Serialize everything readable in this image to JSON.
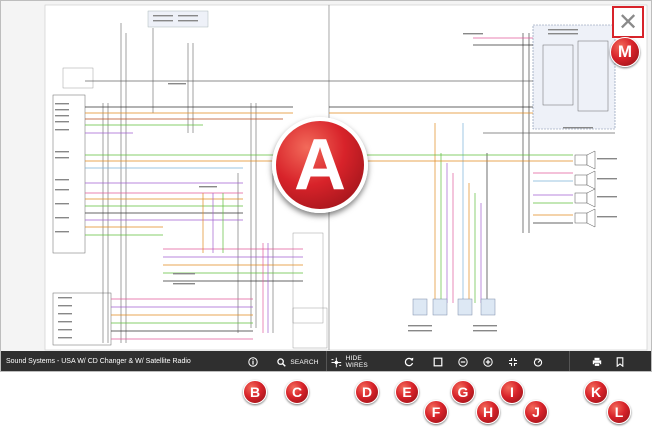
{
  "toolbar": {
    "title": "Sound Systems - USA W/ CD Changer & W/ Satellite Radio",
    "search_label": "SEARCH",
    "hide_wires_label": "HIDE WIRES"
  },
  "close": {
    "glyph": "✕"
  },
  "callouts": {
    "a": "A",
    "b": "B",
    "c": "C",
    "d": "D",
    "e": "E",
    "f": "F",
    "g": "G",
    "h": "H",
    "i": "I",
    "j": "J",
    "k": "K",
    "l": "L",
    "m": "M"
  },
  "colors": {
    "toolbar_bg": "#2f2f2f",
    "callout_red": "#d8232a",
    "wire_orange": "#e08a1e",
    "wire_green": "#5fbf3a",
    "wire_violet": "#a05fd0",
    "wire_pink": "#e05a9a"
  },
  "icons": [
    "info-icon",
    "search-icon",
    "hide-wires-icon",
    "rotate-icon",
    "fit-page-icon",
    "zoom-out-icon",
    "zoom-in-icon",
    "fullscreen-icon",
    "reset-icon",
    "print-icon",
    "bookmark-icon",
    "close-icon"
  ]
}
